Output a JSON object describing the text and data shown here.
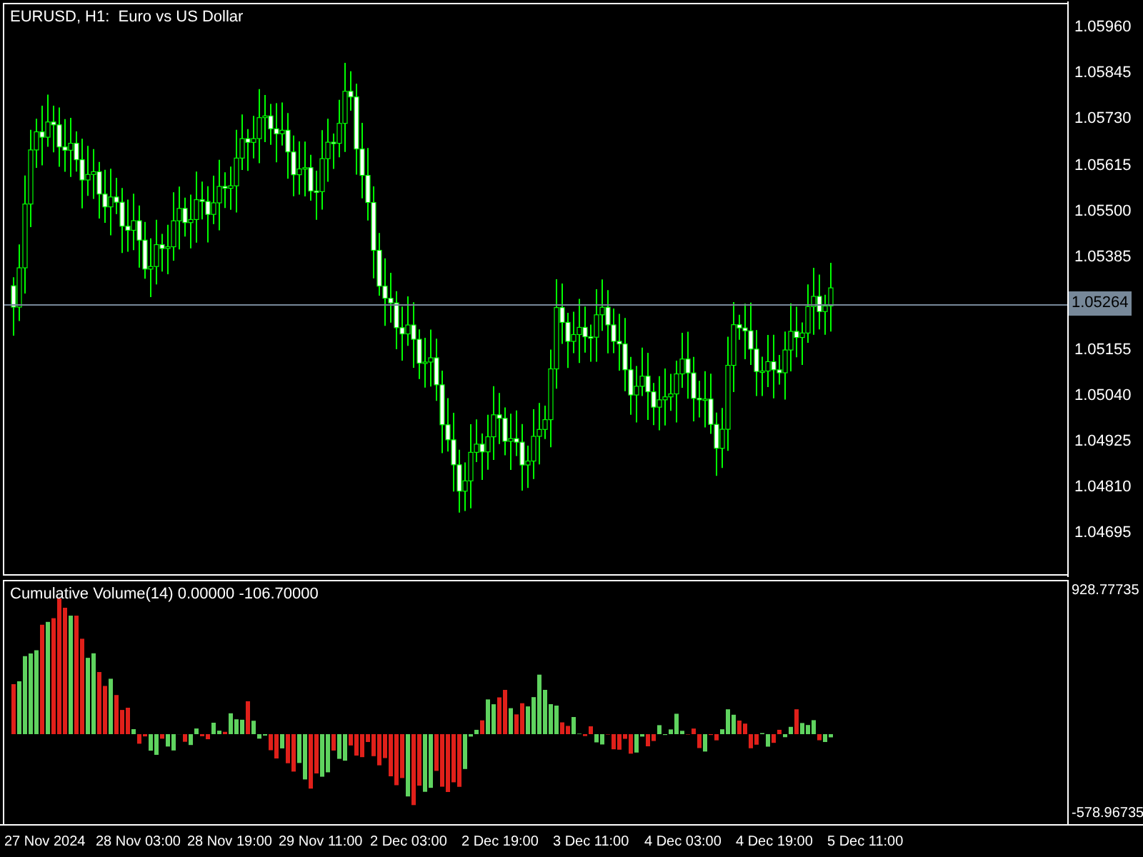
{
  "main_chart": {
    "legend": "EURUSD, H1:  Euro vs US Dollar"
  },
  "price_axis": [
    {
      "label": "1.05960",
      "kind": "tick"
    },
    {
      "label": "1.05845",
      "kind": "tick"
    },
    {
      "label": "1.05730",
      "kind": "tick"
    },
    {
      "label": "1.05615",
      "kind": "tick"
    },
    {
      "label": "1.05500",
      "kind": "tick"
    },
    {
      "label": "1.05385",
      "kind": "tick"
    },
    {
      "label": "1.05264",
      "kind": "current"
    },
    {
      "label": "1.05155",
      "kind": "tick"
    },
    {
      "label": "1.05040",
      "kind": "tick"
    },
    {
      "label": "1.04925",
      "kind": "tick"
    },
    {
      "label": "1.04810",
      "kind": "tick"
    },
    {
      "label": "1.04695",
      "kind": "tick"
    }
  ],
  "indicator": {
    "legend": "Cumulative Volume(14) 0.00000 -106.70000",
    "axis": [
      "928.77735",
      "-578.96735"
    ]
  },
  "time_axis": [
    "27 Nov 2024",
    "28 Nov 03:00",
    "28 Nov 19:00",
    "29 Nov 11:00",
    "2 Dec 03:00",
    "2 Dec 19:00",
    "3 Dec 11:00",
    "4 Dec 03:00",
    "4 Dec 19:00",
    "5 Dec 11:00"
  ]
}
